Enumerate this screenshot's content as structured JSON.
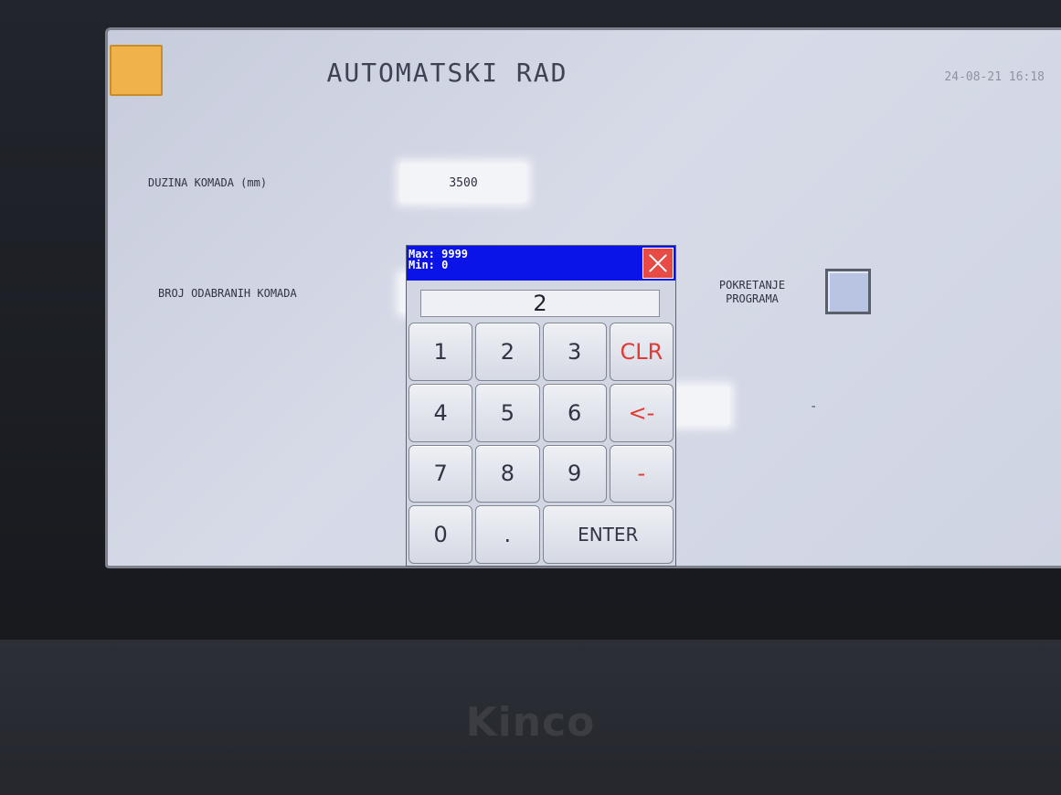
{
  "screen": {
    "title": "AUTOMATSKI RAD",
    "datetime": "24-08-21 16:18",
    "length_label": "DUZINA KOMADA (mm)",
    "length_value": "3500",
    "count_label": "BROJ ODABRANIH KOMADA",
    "start_label": "POKRETANJE PROGRAMA",
    "dash": "-"
  },
  "keypad": {
    "max_text": "Max: 9999",
    "min_text": "Min: 0",
    "display_value": "2",
    "keys": [
      "1",
      "2",
      "3",
      "CLR",
      "4",
      "5",
      "6",
      "<-",
      "7",
      "8",
      "9",
      "-",
      "0",
      ".",
      "ENTER"
    ]
  },
  "device": {
    "brand": "Kinco"
  },
  "colors": {
    "screen_bg": "#d2d6e4",
    "home_button": "#f0b24a",
    "keypad_header": "#0a14e8",
    "close_button": "#e84b45",
    "red_key_text": "#e23a34"
  },
  "icons": {
    "close": "close-icon",
    "home": "home-button"
  }
}
